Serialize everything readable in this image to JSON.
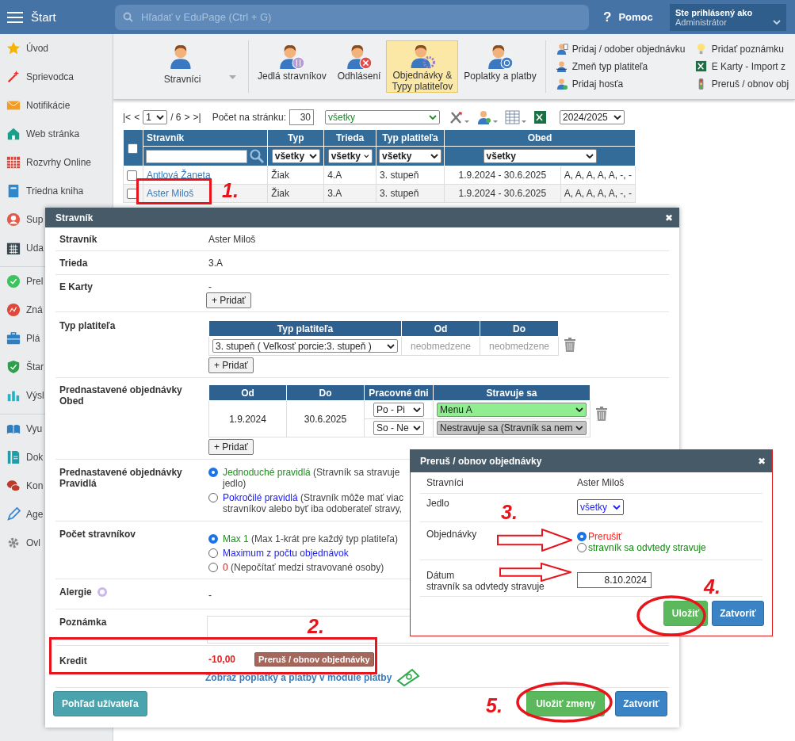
{
  "topbar": {
    "menu_label": "Štart",
    "search_placeholder": "Hľadať v EduPage (Ctrl + G)",
    "help_mark": "?",
    "help_label": "Pomoc",
    "user_caption": "Ste prihlásený ako",
    "user_name": "Administrátor"
  },
  "sidebar": {
    "groups": [
      [
        {
          "label": "Úvod"
        },
        {
          "label": "Sprievodca"
        },
        {
          "label": "Notifikácie"
        },
        {
          "label": "Web stránka"
        },
        {
          "label": "Rozvrhy Online"
        },
        {
          "label": "Triedna kniha"
        },
        {
          "label": "Sup"
        },
        {
          "label": "Uda"
        }
      ],
      [
        {
          "label": "Prel"
        },
        {
          "label": "Zná"
        },
        {
          "label": "Plá"
        },
        {
          "label": "Štar"
        },
        {
          "label": "Výsl"
        }
      ],
      [
        {
          "label": "Vyu"
        },
        {
          "label": "Dok"
        },
        {
          "label": "Kon"
        },
        {
          "label": "Age"
        },
        {
          "label": "Ovl"
        }
      ]
    ]
  },
  "toolbar": {
    "items": [
      {
        "label": "Stravníci",
        "selected": false,
        "dropdown": true
      },
      {
        "label": "Jedlá stravníkov",
        "selected": false,
        "dropdown": false
      },
      {
        "label": "Odhlásení",
        "selected": false,
        "dropdown": false
      },
      {
        "label": "Objednávky &\nTypy platiteľov",
        "selected": true,
        "dropdown": false
      },
      {
        "label": "Poplatky a platby",
        "selected": false,
        "dropdown": false
      }
    ],
    "actions": [
      {
        "label": "Pridaj / odober objednávku"
      },
      {
        "label": "Zmeň typ platiteľa"
      },
      {
        "label": "Pridaj hosťa"
      },
      {
        "label": "Pridať poznámku"
      },
      {
        "label": "E Karty - Import z"
      },
      {
        "label": "Preruš / obnov obj"
      }
    ]
  },
  "pager": {
    "first": "|<",
    "prev": "<",
    "page": "1",
    "of": "/ 6",
    "next": ">",
    "last": ">|",
    "per_page_label": "Počet na stránku:",
    "per_page": "30",
    "filter": "všetky",
    "year": "2024/2025"
  },
  "table": {
    "select_all": {
      "checked": false
    },
    "columns": [
      "Stravník",
      "Typ",
      "Trieda",
      "Typ platiteľa",
      "Obed"
    ],
    "filters": [
      "všetky",
      "všetky",
      "všetky",
      "všetky"
    ],
    "rows": [
      {
        "checked": false,
        "name": "Antlová Žaneta",
        "type": "Žiak",
        "class": "4.A",
        "payer": "3. stupeň",
        "period": "1.9.2024 - 30.6.2025",
        "meals": "A, A, A, A, A, -, -"
      },
      {
        "checked": false,
        "name": "Aster Miloš",
        "type": "Žiak",
        "class": "3.A",
        "payer": "3. stupeň",
        "period": "1.9.2024 - 30.6.2025",
        "meals": "A, A, A, A, A, -, -"
      }
    ]
  },
  "dialog": {
    "title": "Stravník",
    "close": "✖",
    "student": {
      "label": "Stravník",
      "value": "Aster Miloš"
    },
    "class": {
      "label": "Trieda",
      "value": "3.A"
    },
    "ecards": {
      "label": "E Karty",
      "value": "-",
      "add": "+ Pridať"
    },
    "payer": {
      "label": "Typ platiteľa",
      "columns": [
        "Typ platiteľa",
        "Od",
        "Do"
      ],
      "rows": [
        {
          "type": "3. stupeň ( Veľkosť porcie:3. stupeň )",
          "from": "neobmedzene",
          "to": "neobmedzene"
        }
      ],
      "add": "+ Pridať"
    },
    "preset": {
      "label": "Prednastavené objednávky\nObed",
      "columns": [
        "Od",
        "Do",
        "Pracovné dni",
        "Stravuje sa"
      ],
      "from": "1.9.2024",
      "to": "30.6.2025",
      "rows": [
        {
          "days": "Po - Pi",
          "meal": "Menu A",
          "color": "#90ee90"
        },
        {
          "days": "So - Ne",
          "meal": "Nestravuje sa (Stravník sa nem",
          "color": "#c4c4c4"
        }
      ],
      "add": "+ Pridať"
    },
    "rules": {
      "label": "Prednastavené objednávky\nPravidlá",
      "options": [
        {
          "name": "Jednoduché pravidlá",
          "note": " (Stravník sa stravuje\njedlo)",
          "color": "#1f8f1f",
          "selected": true
        },
        {
          "name": "Pokročilé pravidlá",
          "note": " (Stravník môže mať viac\nstravníkov alebo byť iba odoberateľ stravy,",
          "color": "#1a1aff",
          "selected": false
        }
      ]
    },
    "diners": {
      "label": "Počet stravníkov",
      "options": [
        {
          "name": "Max 1",
          "note": " (Max 1-krát pre každý typ platiteľa)",
          "color": "#1f8f1f",
          "selected": true
        },
        {
          "name": "Maximum z počtu objednávok",
          "color": "#1a1aff",
          "selected": false
        },
        {
          "name": "0",
          "note": " (Nepočítať medzi stravované osoby)",
          "color": "#cc2222",
          "selected": false
        }
      ]
    },
    "allergy": {
      "label": "Alergie",
      "value": "-"
    },
    "note": {
      "label": "Poznámka"
    },
    "credit": {
      "label": "Kredit",
      "value": "-10,00",
      "button": "Preruš / obnov objednávky",
      "link": "Zobraz poplatky a platby v module platby"
    },
    "footer": {
      "user_view": "Pohľad užívateľa",
      "save": "Uložiť zmeny",
      "close": "Zatvoriť"
    }
  },
  "pause_dialog": {
    "title": "Preruš / obnov objednávky",
    "close": "✖",
    "diners": {
      "label": "Stravníci",
      "value": "Aster Miloš"
    },
    "meal": {
      "label": "Jedlo",
      "value": "všetky"
    },
    "orders": {
      "label": "Objednávky",
      "options": [
        {
          "label": "Prerušiť",
          "color": "#ff2020",
          "selected": true
        },
        {
          "label": "stravník sa odvtedy stravuje",
          "color": "#128a12",
          "selected": false
        }
      ]
    },
    "date": {
      "label": "Dátum\nstravník sa odvtedy stravuje",
      "value": "8.10.2024"
    },
    "save": "Uložiť",
    "cancel": "Zatvoriť"
  },
  "annotations": {
    "steps": [
      "1.",
      "2.",
      "3.",
      "4.",
      "5."
    ]
  }
}
